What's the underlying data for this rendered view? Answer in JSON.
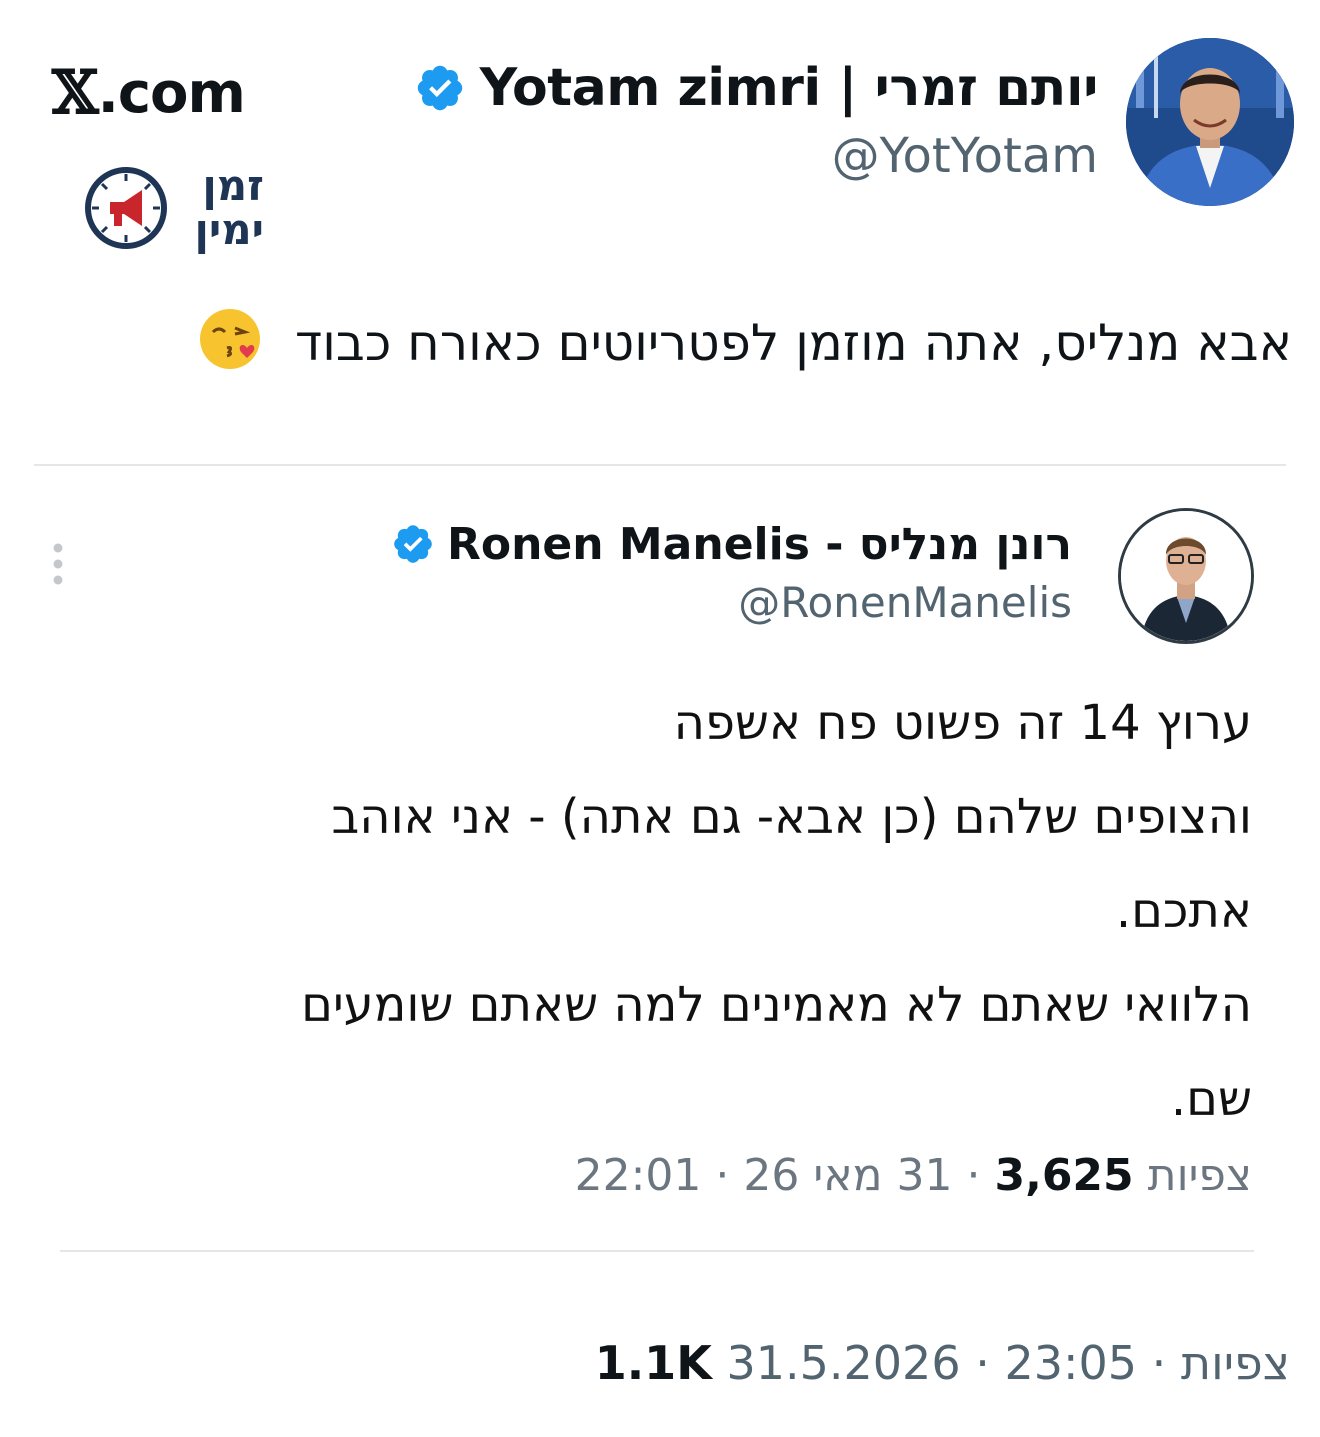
{
  "outer_tweet": {
    "display_name": "Yotam zimri | יותם זמרי",
    "handle": "@YotYotam",
    "verified": true,
    "text": "אבא מנליס, אתה מוזמן לפטריוטים כאורח כבוד",
    "emoji": "face-blowing-a-kiss",
    "date": "31.5.2026",
    "time": "23:05",
    "views_count": "1.1K",
    "views_label": "צפיות"
  },
  "site": {
    "name": ".com",
    "logo": "x-logo"
  },
  "channel_logo": {
    "line1": "זמן",
    "line2": "ימין",
    "icon": "clock-megaphone-icon"
  },
  "quoted_tweet": {
    "display_name": "Ronen Manelis - רונן מנליס",
    "handle": "@RonenManelis",
    "verified": true,
    "lines": [
      "ערוץ 14 זה פשוט פח אשפה",
      "והצופים שלהם (כן אבא- גם אתה) - אני אוהב",
      "אתכם.",
      "הלוואי שאתם לא מאמינים למה שאתם שומעים",
      "שם."
    ],
    "time": "22:01",
    "date": "31 מאי 26",
    "views_count": "3,625",
    "views_label": "צפיות"
  },
  "colors": {
    "verified_badge": "#1d9bf0",
    "handle_gray": "#536471",
    "divider": "#e3e7ea",
    "logo_navy": "#1f3556",
    "logo_red": "#c8262c"
  }
}
